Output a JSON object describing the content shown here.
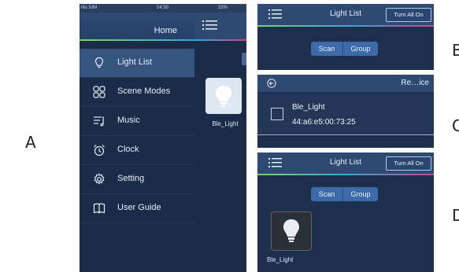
{
  "letters": [
    "A",
    "B",
    "C",
    "D"
  ],
  "panelA": {
    "status": {
      "carrier": "No SIM",
      "time": "14:50",
      "battery": "33%"
    },
    "drawer_title": "Home",
    "menu_items": [
      {
        "label": "Light List",
        "icon": "bulb-icon",
        "active": true
      },
      {
        "label": "Scene Modes",
        "icon": "scene-modes-icon",
        "active": false
      },
      {
        "label": "Music",
        "icon": "music-icon",
        "active": false
      },
      {
        "label": "Clock",
        "icon": "alarm-clock-icon",
        "active": false
      },
      {
        "label": "Setting",
        "icon": "gear-icon",
        "active": false
      },
      {
        "label": "User Guide",
        "icon": "book-icon",
        "active": false
      }
    ],
    "peek_light_label": "Ble_Light"
  },
  "panelB": {
    "title": "Light List",
    "turn_all_on": "Turn All On",
    "scan": "Scan",
    "group": "Group"
  },
  "panelC": {
    "title": "Re…ice",
    "device_name": "Ble_Light",
    "device_mac": "44:a6:e5:00:73:25",
    "checked": false
  },
  "panelD": {
    "title": "Light List",
    "turn_all_on": "Turn All On",
    "scan": "Scan",
    "group": "Group",
    "light_label": "Ble_Light"
  },
  "colors": {
    "header": "#2f4a72",
    "background": "#1e2f4d",
    "accent": "#3d6aa8"
  }
}
